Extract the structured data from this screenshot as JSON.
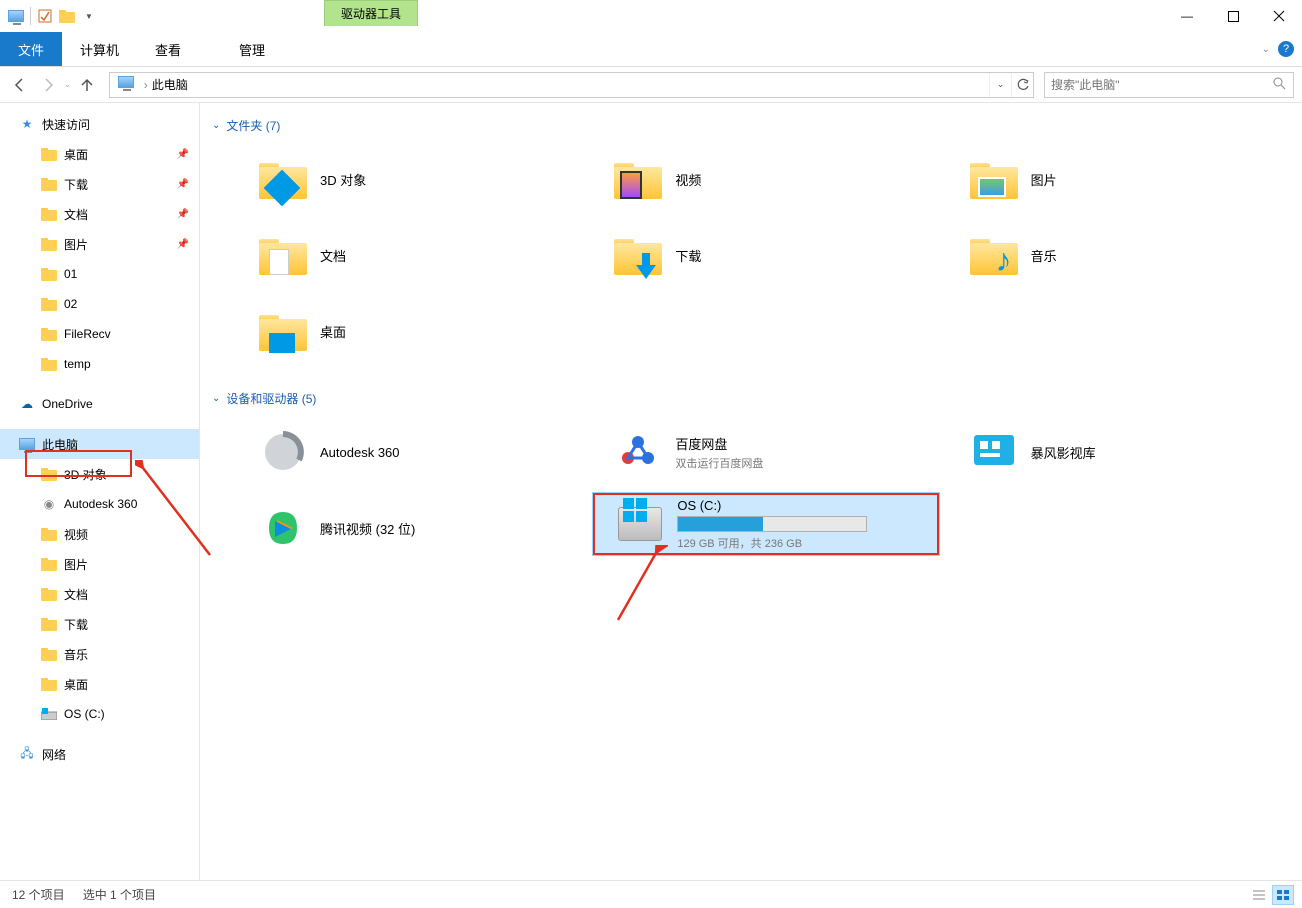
{
  "window": {
    "title": "此电脑",
    "context_tab": "驱动器工具"
  },
  "menubar": {
    "file": "文件",
    "computer": "计算机",
    "view": "查看",
    "manage": "管理"
  },
  "toolbar": {
    "breadcrumb": "此电脑",
    "search_placeholder": "搜索\"此电脑\""
  },
  "sidebar": {
    "quick_access": "快速访问",
    "quick_items": [
      {
        "label": "桌面",
        "pinned": true,
        "icon": "desktop"
      },
      {
        "label": "下载",
        "pinned": true,
        "icon": "downloads"
      },
      {
        "label": "文档",
        "pinned": true,
        "icon": "documents"
      },
      {
        "label": "图片",
        "pinned": true,
        "icon": "pictures"
      },
      {
        "label": "01",
        "pinned": false,
        "icon": "folder"
      },
      {
        "label": "02",
        "pinned": false,
        "icon": "folder"
      },
      {
        "label": "FileRecv",
        "pinned": false,
        "icon": "folder"
      },
      {
        "label": "temp",
        "pinned": false,
        "icon": "folder"
      }
    ],
    "onedrive": "OneDrive",
    "this_pc": "此电脑",
    "pc_items": [
      {
        "label": "3D 对象"
      },
      {
        "label": "Autodesk 360"
      },
      {
        "label": "视频"
      },
      {
        "label": "图片"
      },
      {
        "label": "文档"
      },
      {
        "label": "下载"
      },
      {
        "label": "音乐"
      },
      {
        "label": "桌面"
      },
      {
        "label": "OS (C:)"
      }
    ],
    "network": "网络"
  },
  "groups": {
    "folders_header": "文件夹 (7)",
    "devices_header": "设备和驱动器 (5)"
  },
  "folders": [
    {
      "label": "3D 对象"
    },
    {
      "label": "视频"
    },
    {
      "label": "图片"
    },
    {
      "label": "文档"
    },
    {
      "label": "下载"
    },
    {
      "label": "音乐"
    },
    {
      "label": "桌面"
    }
  ],
  "devices": [
    {
      "label": "Autodesk 360",
      "sub": ""
    },
    {
      "label": "百度网盘",
      "sub": "双击运行百度网盘"
    },
    {
      "label": "暴风影视库",
      "sub": ""
    },
    {
      "label": "腾讯视频 (32 位)",
      "sub": ""
    }
  ],
  "drive": {
    "label": "OS (C:)",
    "free_text": "129 GB 可用，共 236 GB",
    "used_percent": 45
  },
  "statusbar": {
    "items": "12 个项目",
    "selected": "选中 1 个项目"
  }
}
